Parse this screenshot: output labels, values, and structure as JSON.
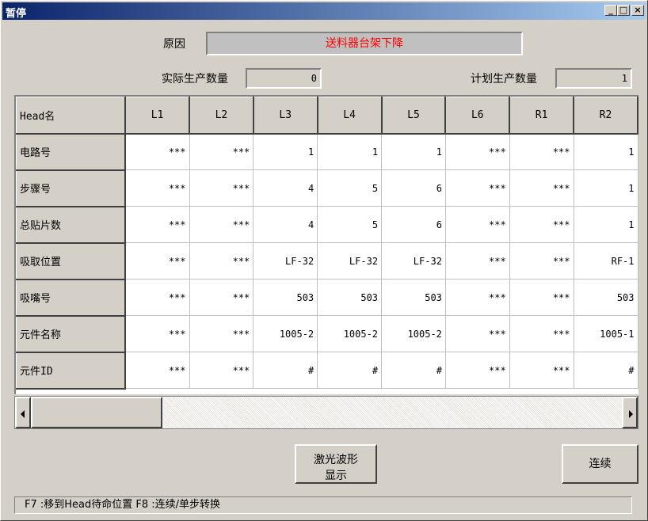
{
  "window": {
    "title": "暂停"
  },
  "title_buttons": {
    "minimize": "_",
    "maximize": "□",
    "close": "×"
  },
  "reason": {
    "label": "原因",
    "value": "送料器台架下降"
  },
  "actual": {
    "label": "实际生产数量",
    "value": "0"
  },
  "planned": {
    "label": "计划生产数量",
    "value": "1"
  },
  "table": {
    "corner": "Head名",
    "columns": [
      "L1",
      "L2",
      "L3",
      "L4",
      "L5",
      "L6",
      "R1",
      "R2"
    ],
    "rows": [
      {
        "label": "电路号",
        "cells": [
          "***",
          "***",
          "1",
          "1",
          "1",
          "***",
          "***",
          "1"
        ]
      },
      {
        "label": "步骤号",
        "cells": [
          "***",
          "***",
          "4",
          "5",
          "6",
          "***",
          "***",
          "1"
        ]
      },
      {
        "label": "总贴片数",
        "cells": [
          "***",
          "***",
          "4",
          "5",
          "6",
          "***",
          "***",
          "1"
        ]
      },
      {
        "label": "吸取位置",
        "cells": [
          "***",
          "***",
          "LF-32",
          "LF-32",
          "LF-32",
          "***",
          "***",
          "RF-1"
        ]
      },
      {
        "label": "吸嘴号",
        "cells": [
          "***",
          "***",
          "503",
          "503",
          "503",
          "***",
          "***",
          "503"
        ]
      },
      {
        "label": "元件名称",
        "cells": [
          "***",
          "***",
          "1005-2",
          "1005-2",
          "1005-2",
          "***",
          "***",
          "1005-1"
        ]
      },
      {
        "label": "元件ID",
        "cells": [
          "***",
          "***",
          "#",
          "#",
          "#",
          "***",
          "***",
          "#"
        ]
      }
    ]
  },
  "buttons": {
    "laser_line1": "激光波形",
    "laser_line2": "显示",
    "continue": "连续"
  },
  "status": {
    "text": "F7 :移到Head待命位置  F8 :连续/单步转换"
  }
}
